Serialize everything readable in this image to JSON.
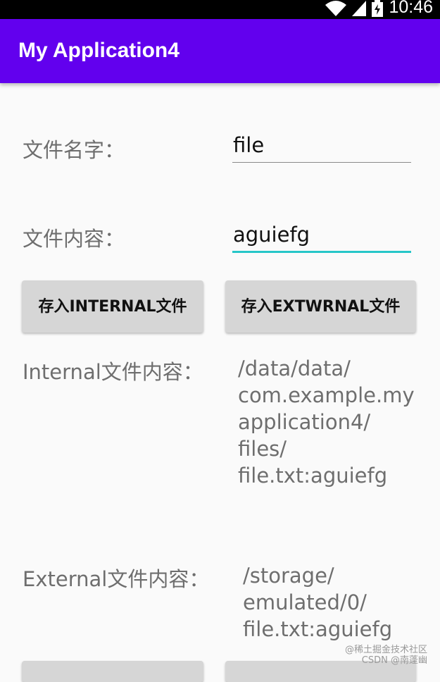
{
  "status_bar": {
    "time": "10:46",
    "icons": [
      "wifi-icon",
      "signal-icon",
      "battery-charging-icon"
    ]
  },
  "app_bar": {
    "title": "My Application4",
    "color": "#6200ee"
  },
  "form": {
    "file_name_label": "文件名字：",
    "file_name_value": "file",
    "file_content_label": "文件内容：",
    "file_content_value": "aguiefg",
    "focus_color": "#26c6c8"
  },
  "buttons": {
    "save_internal_label": "存入INTERNAL文件",
    "save_external_label": "存入EXTWRNAL文件"
  },
  "results": {
    "internal_label": "Internal文件内容：",
    "internal_lines": [
      "/data/data/",
      "com.example.my",
      "application4/",
      "files/",
      "file.txt:aguiefg"
    ],
    "external_label": "External文件内容：",
    "external_lines": [
      "/storage/",
      "emulated/0/",
      "file.txt:aguiefg"
    ]
  },
  "watermark": {
    "line1": "@稀土掘金技术社区",
    "line2": "CSDN @南蓬幽"
  }
}
